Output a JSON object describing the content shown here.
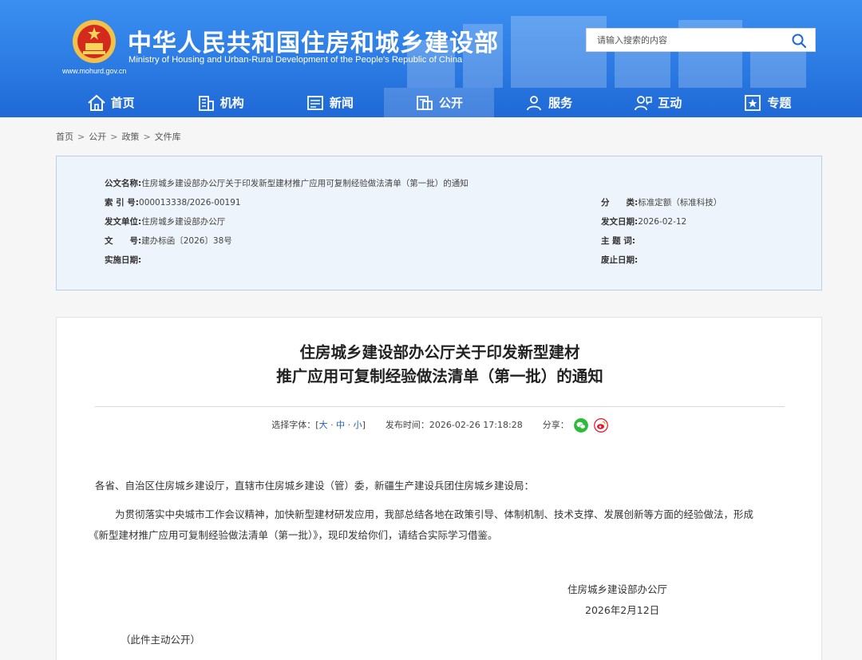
{
  "header": {
    "title": "中华人民共和国住房和城乡建设部",
    "subtitle": "Ministry of Housing and Urban-Rural Development of the People's Republic of China",
    "domain": "www.mohurd.gov.cn",
    "search_placeholder": "请输入搜索的内容"
  },
  "nav": [
    {
      "label": "首页",
      "icon": "home-icon"
    },
    {
      "label": "机构",
      "icon": "building-icon"
    },
    {
      "label": "新闻",
      "icon": "news-icon"
    },
    {
      "label": "公开",
      "icon": "disclosure-icon",
      "active": true
    },
    {
      "label": "服务",
      "icon": "service-icon"
    },
    {
      "label": "互动",
      "icon": "interact-icon"
    },
    {
      "label": "专题",
      "icon": "topic-icon"
    }
  ],
  "breadcrumb": [
    "首页",
    "公开",
    "政策",
    "文件库"
  ],
  "meta": {
    "name_label": "公文名称:",
    "name_value": "住房城乡建设部办公厅关于印发新型建材推广应用可复制经验做法清单（第一批）的通知",
    "index_label": "索 引 号:",
    "index_value": "000013338/2026-00191",
    "category_label": "分　　类:",
    "category_value": "标准定额（标准科技）",
    "issuer_label": "发文单位:",
    "issuer_value": "住房城乡建设部办公厅",
    "issue_date_label": "发文日期:",
    "issue_date_value": "2026-02-12",
    "docno_label": "文　　号:",
    "docno_value": "建办标函〔2026〕38号",
    "keywords_label": "主 题 词:",
    "keywords_value": "",
    "effective_label": "实施日期:",
    "effective_value": "",
    "expire_label": "废止日期:",
    "expire_value": ""
  },
  "article": {
    "title_line1": "住房城乡建设部办公厅关于印发新型建材",
    "title_line2": "推广应用可复制经验做法清单（第一批）的通知",
    "font_label": "选择字体：[",
    "font_large": "大",
    "font_medium": "中",
    "font_small": "小",
    "font_close": "]",
    "publish_label": "发布时间：",
    "publish_time": "2026-02-26 17:18:28",
    "share_label": "分享：",
    "salutation": "各省、自治区住房城乡建设厅，直辖市住房城乡建设（管）委，新疆生产建设兵团住房城乡建设局：",
    "body_line1": "为贯彻落实中央城市工作会议精神，加快新型建材研发应用，我部总结各地在政策引导、体制机制、技术支撑、发展创新等方面的经验做法，形成",
    "body_line2": "《新型建材推广应用可复制经验做法清单（第一批）》，现印发给你们，请结合实际学习借鉴。",
    "signature_org": "住房城乡建设部办公厅",
    "signature_date": "2026年2月12日",
    "publicity_note": "（此件主动公开）"
  },
  "colors": {
    "header_blue": "#2f7fe6",
    "link_blue": "#1f5fb7",
    "meta_bg": "#eef4fb",
    "wechat": "#2dbb3b",
    "weibo": "#e6162d"
  }
}
